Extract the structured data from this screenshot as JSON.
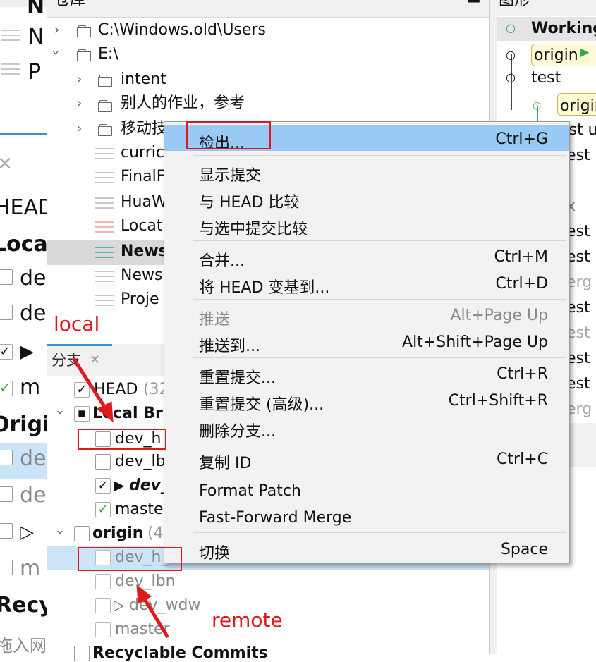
{
  "left_panel": {
    "rows": [
      {
        "label": "N"
      },
      {
        "label": "N"
      },
      {
        "label": "P"
      }
    ],
    "head_label": "HEAD",
    "local_label": "Local",
    "local_items": [
      "de",
      "de",
      "",
      "m"
    ],
    "origin_label": "Origin",
    "origin_items": [
      "de",
      "de",
      "",
      "m"
    ],
    "recycle_label": "Recy",
    "bottom_text": "拖入网"
  },
  "repo_panel": {
    "tab": "仓库",
    "items": [
      {
        "label": "C:\\Windows.old\\Users",
        "type": "folder",
        "level": 0
      },
      {
        "label": "E:\\",
        "type": "folder",
        "level": 0
      },
      {
        "label": "intent",
        "type": "folder",
        "level": 1
      },
      {
        "label": "别人的作业，参考",
        "type": "folder",
        "level": 1
      },
      {
        "label": "移动技",
        "type": "folder",
        "level": 1
      },
      {
        "label": "curric",
        "type": "repo",
        "level": 1
      },
      {
        "label": "FinalF",
        "type": "repo",
        "level": 1
      },
      {
        "label": "HuaW",
        "type": "repo",
        "level": 1
      },
      {
        "label": "Locat",
        "type": "repo",
        "level": 1
      },
      {
        "label": "News",
        "type": "repo",
        "level": 1
      },
      {
        "label": "News",
        "type": "repo",
        "level": 1
      },
      {
        "label": "Proje",
        "type": "repo",
        "level": 1
      }
    ]
  },
  "branch_panel": {
    "tab": "分支",
    "items": [
      {
        "label": "HEAD",
        "suffix": "(32"
      },
      {
        "label": "Local Bra",
        "suffix": ""
      },
      {
        "label": "dev_h",
        "suffix": ""
      },
      {
        "label": "dev_lb",
        "suffix": ""
      },
      {
        "label": "dev_",
        "suffix": ""
      },
      {
        "label": "maste",
        "suffix": ""
      },
      {
        "label": "origin",
        "suffix": "(4"
      },
      {
        "label": "dev_h_",
        "suffix": ""
      },
      {
        "label": "dev_lbn",
        "suffix": ""
      },
      {
        "label": "dev_wdw",
        "suffix": ""
      },
      {
        "label": "master",
        "suffix": ""
      },
      {
        "label": "Recyclable Commits",
        "suffix": ""
      }
    ]
  },
  "graph_panel": {
    "tab": "图形",
    "header": "Working",
    "tag1": "origin",
    "tag2": "origin",
    "rows": [
      "test",
      "est u",
      "est",
      "x",
      "est",
      "est",
      "erg",
      "est",
      "est",
      "est u",
      "est 3",
      "erg"
    ]
  },
  "context_menu": {
    "items": [
      {
        "label": "检出...",
        "shortcut": "Ctrl+G"
      },
      {
        "label": "显示提交",
        "shortcut": ""
      },
      {
        "label": "与 HEAD 比较",
        "shortcut": ""
      },
      {
        "label": "与选中提交比较",
        "shortcut": ""
      },
      {
        "label": "合并...",
        "shortcut": "Ctrl+M"
      },
      {
        "label": "将 HEAD 变基到...",
        "shortcut": "Ctrl+D"
      },
      {
        "label": "推送",
        "shortcut": "Alt+Page Up"
      },
      {
        "label": "推送到...",
        "shortcut": "Alt+Shift+Page Up"
      },
      {
        "label": "重置提交...",
        "shortcut": "Ctrl+R"
      },
      {
        "label": "重置提交 (高级)...",
        "shortcut": "Ctrl+Shift+R"
      },
      {
        "label": "删除分支...",
        "shortcut": ""
      },
      {
        "label": "复制 ID",
        "shortcut": "Ctrl+C"
      },
      {
        "label": "Format Patch",
        "shortcut": ""
      },
      {
        "label": "Fast-Forward Merge",
        "shortcut": ""
      },
      {
        "label": "切换",
        "shortcut": "Space"
      }
    ]
  },
  "annotations": {
    "local": "local",
    "remote": "remote"
  },
  "colors": {
    "highlight": "#99c9f5",
    "selection": "#cce4f7",
    "annotation_red": "#e0191b",
    "menu_bg": "#f2f2f2"
  }
}
